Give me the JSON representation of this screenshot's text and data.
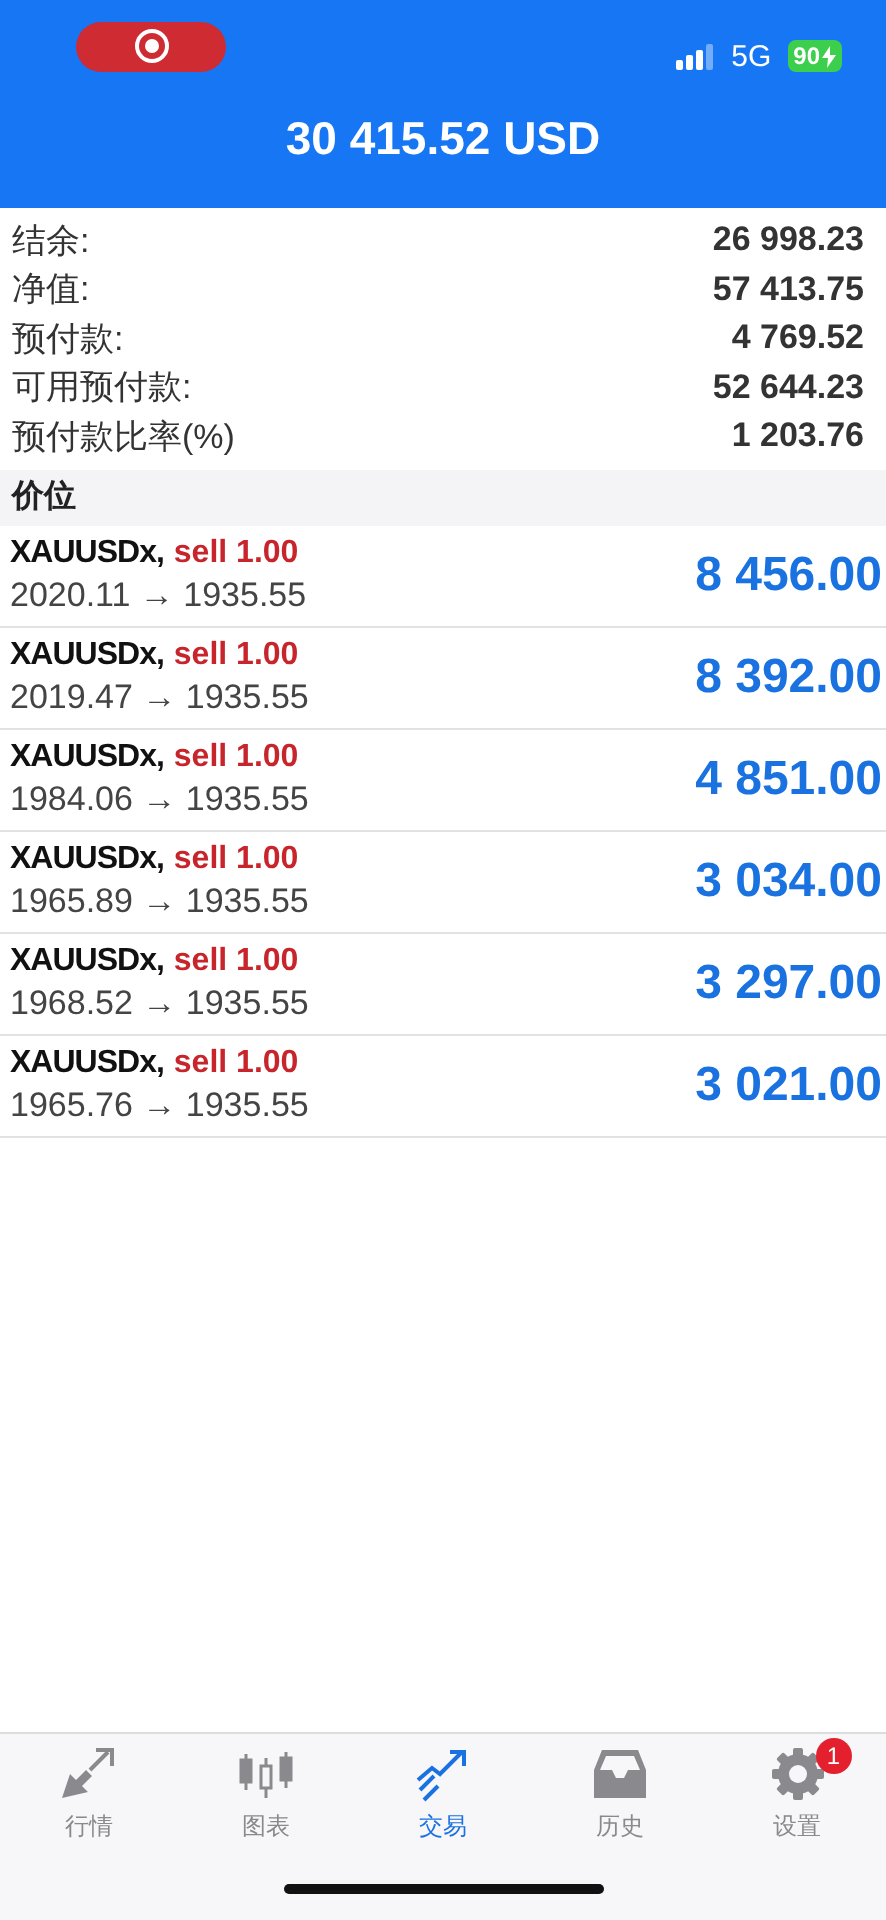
{
  "status_bar": {
    "network": "5G",
    "battery": "90",
    "charging": true
  },
  "header": {
    "balance": "30 415.52 USD"
  },
  "summary": [
    {
      "label": "结余:",
      "value": "26 998.23"
    },
    {
      "label": "净值:",
      "value": "57 413.75"
    },
    {
      "label": "预付款:",
      "value": "4 769.52"
    },
    {
      "label": "可用预付款:",
      "value": "52 644.23"
    },
    {
      "label": "预付款比率(%)",
      "value": "1 203.76"
    }
  ],
  "section": {
    "title": "价位"
  },
  "positions": [
    {
      "symbol": "XAUUSDx,",
      "action": "sell 1.00",
      "prices": "2020.11 → 1935.55",
      "profit": "8 456.00"
    },
    {
      "symbol": "XAUUSDx,",
      "action": "sell 1.00",
      "prices": "2019.47 → 1935.55",
      "profit": "8 392.00"
    },
    {
      "symbol": "XAUUSDx,",
      "action": "sell 1.00",
      "prices": "1984.06 → 1935.55",
      "profit": "4 851.00"
    },
    {
      "symbol": "XAUUSDx,",
      "action": "sell 1.00",
      "prices": "1965.89 → 1935.55",
      "profit": "3 034.00"
    },
    {
      "symbol": "XAUUSDx,",
      "action": "sell 1.00",
      "prices": "1968.52 → 1935.55",
      "profit": "3 297.00"
    },
    {
      "symbol": "XAUUSDx,",
      "action": "sell 1.00",
      "prices": "1965.76 → 1935.55",
      "profit": "3 021.00"
    }
  ],
  "tabs": [
    {
      "kind": "quotes",
      "label": "行情",
      "selected": false
    },
    {
      "kind": "chart",
      "label": "图表",
      "selected": false
    },
    {
      "kind": "trade",
      "label": "交易",
      "selected": true
    },
    {
      "kind": "history",
      "label": "历史",
      "selected": false
    },
    {
      "kind": "settings",
      "label": "设置",
      "selected": false,
      "badge": "1"
    }
  ]
}
